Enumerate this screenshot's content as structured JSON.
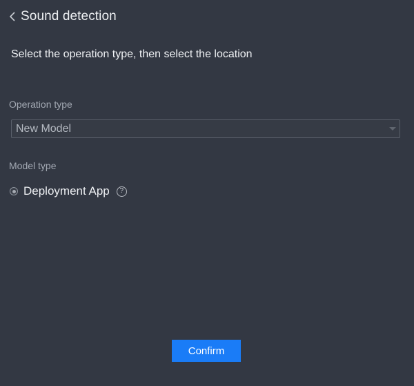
{
  "header": {
    "title": "Sound detection",
    "back_icon": "chevron-left-icon"
  },
  "instruction": "Select the operation type, then select the location",
  "operation_type": {
    "label": "Operation type",
    "selected": "New Model"
  },
  "model_type": {
    "label": "Model type",
    "option_label": "Deployment App",
    "selected": true,
    "help_glyph": "?"
  },
  "confirm_label": "Confirm",
  "colors": {
    "background": "#333843",
    "accent": "#1a7cf7"
  }
}
